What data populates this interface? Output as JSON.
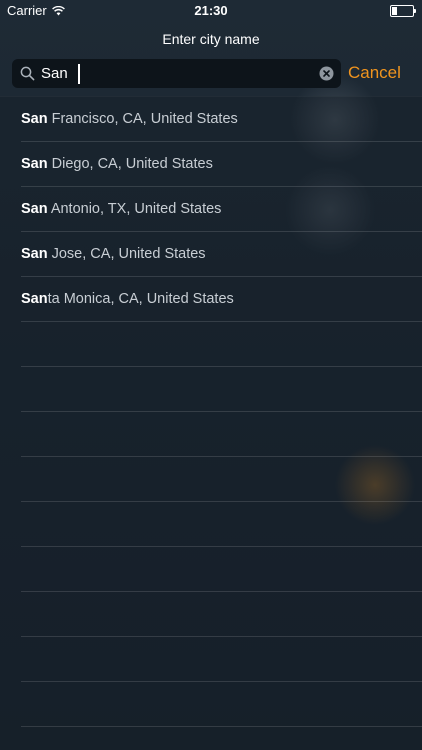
{
  "status_bar": {
    "carrier": "Carrier",
    "time": "21:30",
    "battery_level": 0.25
  },
  "header": {
    "title": "Enter city name"
  },
  "search": {
    "value": "San",
    "cancel_label": "Cancel"
  },
  "results": [
    {
      "match": "San",
      "rest": " Francisco, CA, United States"
    },
    {
      "match": "San",
      "rest": " Diego, CA, United States"
    },
    {
      "match": "San",
      "rest": " Antonio, TX, United States"
    },
    {
      "match": "San",
      "rest": " Jose, CA, United States"
    },
    {
      "match": "San",
      "rest": "ta Monica, CA, United States"
    }
  ],
  "colors": {
    "accent": "#f0941e",
    "background": "#1c2630",
    "search_field": "#0d141a"
  }
}
